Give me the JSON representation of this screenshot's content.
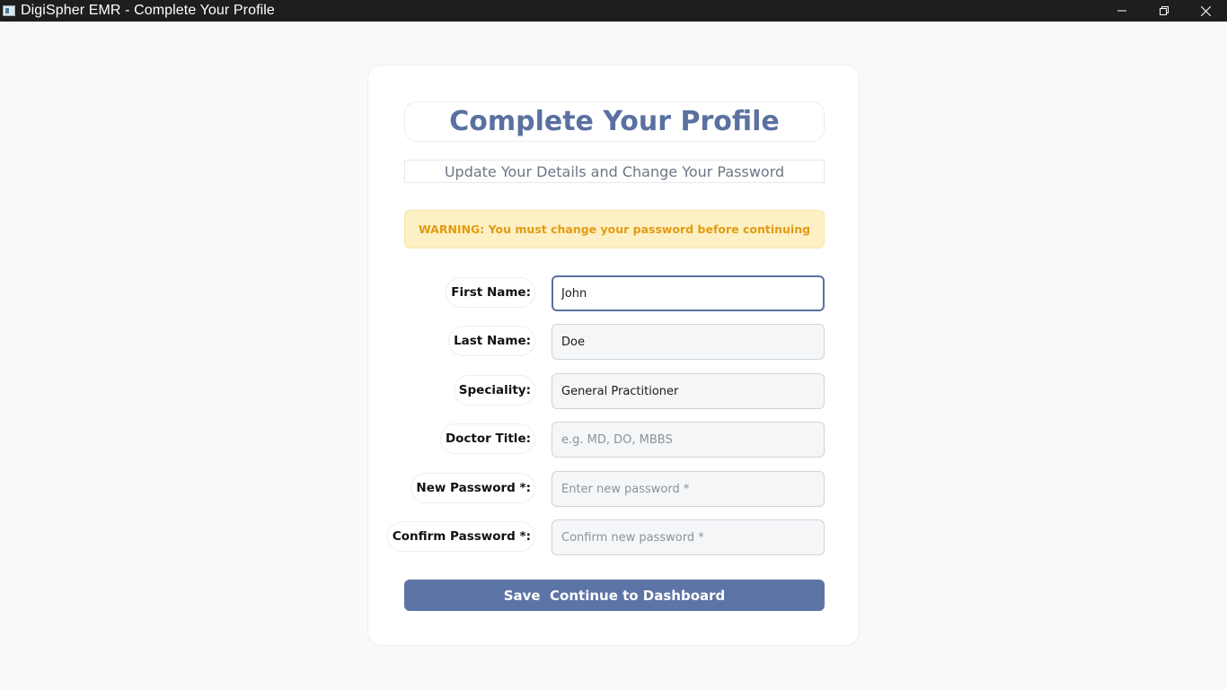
{
  "window": {
    "title": "DigiSpher EMR - Complete Your Profile",
    "icon": "app-window-icon",
    "controls": [
      "minimize-icon",
      "restore-icon",
      "close-icon"
    ]
  },
  "profile": {
    "title": "Complete Your Profile",
    "subtitle": "Update Your Details and Change Your Password",
    "warning": "WARNING: You must change your password before continuing",
    "fields": [
      {
        "label": "First Name:",
        "value": "John",
        "placeholder": ""
      },
      {
        "label": "Last Name:",
        "value": "Doe",
        "placeholder": ""
      },
      {
        "label": "Speciality:",
        "value": "General Practitioner",
        "placeholder": ""
      },
      {
        "label": "Doctor Title:",
        "value": "",
        "placeholder": "e.g. MD, DO, MBBS"
      },
      {
        "label": "New Password *:",
        "value": "",
        "placeholder": "Enter new password *"
      },
      {
        "label": "Confirm Password *:",
        "value": "",
        "placeholder": "Confirm new password *"
      }
    ],
    "submit_label": "Save  Continue to Dashboard"
  },
  "colors": {
    "accent": "#5a70a0",
    "button": "#5d74a6",
    "warning_bg": "#fdf0c4",
    "warning_text": "#e29b12",
    "titlebar": "#1e1e1e"
  }
}
